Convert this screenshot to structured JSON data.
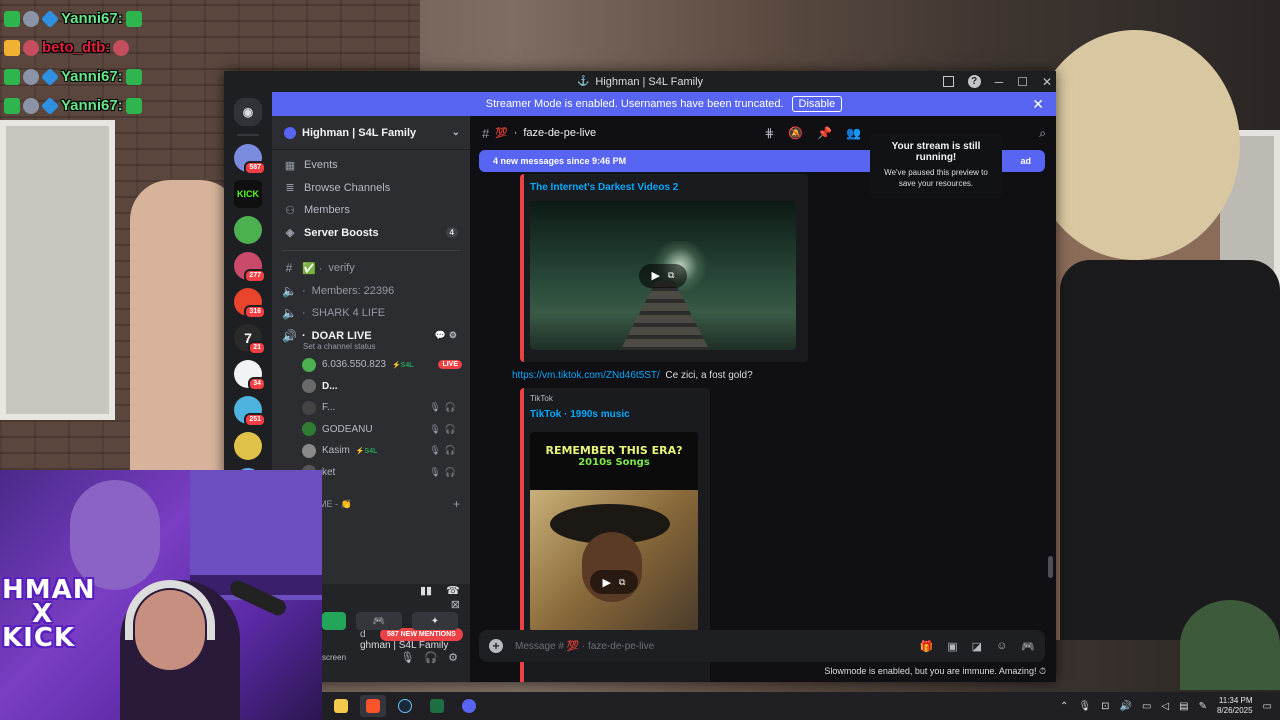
{
  "chat_overlay": [
    {
      "user": "Yanni67:",
      "color": "#67e88a"
    },
    {
      "user": "beto_dtb:",
      "color": "#e0213a"
    },
    {
      "user": "Yanni67:",
      "color": "#67e88a"
    },
    {
      "user": "Yanni67:",
      "color": "#67e88a"
    }
  ],
  "webcam": {
    "overlay_text_1": "HMAN",
    "overlay_text_2": "X",
    "overlay_text_3": "KICK"
  },
  "window": {
    "title": "Highman | S4L Family"
  },
  "notice": {
    "text": "Streamer Mode is enabled. Usernames have been truncated.",
    "button": "Disable"
  },
  "rail": {
    "servers": [
      {
        "name": "server-1",
        "count": "587",
        "color": "#7b8cde"
      },
      {
        "name": "kick",
        "label": "KICK",
        "count": ""
      },
      {
        "name": "server-3",
        "count": "",
        "color": "#4caf50"
      },
      {
        "name": "server-4",
        "count": "277",
        "color": "#c94a6a"
      },
      {
        "name": "server-5",
        "count": "316",
        "color": "#e8452c"
      },
      {
        "name": "server-6",
        "label": "7",
        "count": "21",
        "color": "#2a2a2a"
      },
      {
        "name": "server-7",
        "count": "34",
        "color": "#f2f3f5"
      },
      {
        "name": "server-8",
        "count": "251",
        "color": "#4fb3e0"
      },
      {
        "name": "server-9",
        "count": "",
        "color": "#e0c24a"
      },
      {
        "name": "server-10",
        "count": "",
        "color": "#6aa5e0"
      },
      {
        "name": "server-11",
        "count": "",
        "color": "#d9b24a"
      }
    ]
  },
  "sidebar": {
    "server_name": "Highman | S4L Family",
    "nav": [
      {
        "label": "Events"
      },
      {
        "label": "Browse Channels"
      },
      {
        "label": "Members"
      },
      {
        "label": "Server Boosts",
        "pill": "4"
      }
    ],
    "channels": [
      {
        "label": "verify",
        "prefix": "✅ ·"
      },
      {
        "label": "Members: 22396",
        "prefix": "·"
      },
      {
        "label": "SHARK 4 LIFE",
        "prefix": "·"
      },
      {
        "label": "DOAR LIVE",
        "prefix": "·"
      }
    ],
    "channel_status": "Set a channel status",
    "voice_users": [
      {
        "name": "6.036.550.823",
        "tag": "⚡S4L",
        "live": "LIVE"
      },
      {
        "name": "D..."
      },
      {
        "name": "F..."
      },
      {
        "name": "GODEANU"
      },
      {
        "name": "Kasim",
        "tag": "⚡S4L"
      },
      {
        "name": "ket"
      }
    ],
    "category": "OME - 👏",
    "mentions_pill": "587 NEW MENTIONS",
    "partial_item": "t",
    "voice_panel": {
      "status": "d",
      "server": "ghman | S4L Family"
    },
    "user_panel": {
      "status": "screen"
    }
  },
  "main": {
    "channel_name": "faze-de-pe-live",
    "new_messages": "4 new messages since 9:46 PM",
    "mark_read": "ad",
    "embed1": {
      "title": "The Internet's Darkest Videos 2"
    },
    "message": {
      "link": "https://vm.tiktok.com/ZNd46t5ST/",
      "text": "Ce zici, a fost gold?"
    },
    "embed2": {
      "provider": "TikTok",
      "title": "TikTok · 1990s music",
      "banner_1": "REMEMBER THIS ERA?",
      "banner_2": "2010s Songs"
    },
    "composer_placeholder": "Message # 💯 · faze-de-pe-live",
    "slowmode": "Slowmode is enabled, but you are immune. Amazing!"
  },
  "toast": {
    "title": "Your stream is still running!",
    "body": "We've paused this preview to save your resources."
  },
  "taskbar": {
    "apps": [
      {
        "name": "file-explorer",
        "color": "#f2c94c"
      },
      {
        "name": "brave",
        "color": "#fb542b"
      },
      {
        "name": "steam",
        "color": "#1b2838"
      },
      {
        "name": "excel",
        "color": "#1d6f42"
      },
      {
        "name": "discord",
        "color": "#5865f2"
      }
    ],
    "time": "11:34 PM",
    "date": "8/26/2025"
  }
}
